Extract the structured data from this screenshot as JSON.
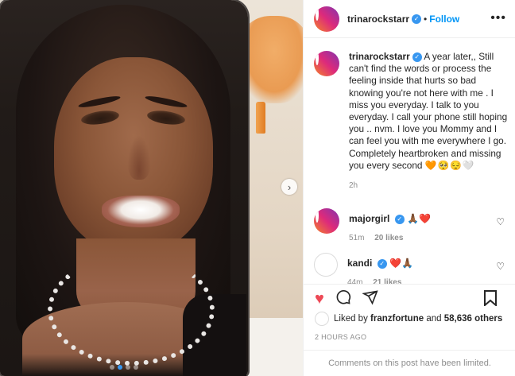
{
  "post": {
    "owner": "trinarockstarr",
    "follow_label": "Follow",
    "separator": "•",
    "more_icon": "more-horizontal-icon",
    "next_icon": "chevron-right-icon",
    "carousel_index": 2,
    "carousel_count": 4,
    "colors": {
      "accent": "#0095f6",
      "like": "#ed4956",
      "verified": "#3897f0",
      "muted": "#8e8e8e"
    }
  },
  "caption": {
    "username": "trinarockstarr",
    "text": "A year later,, Still can't find the words or process the feeling inside that hurts so bad knowing you're not here with me . I miss you everyday. I talk to you everyday. I call your phone still hoping you .. nvm. I love you Mommy and I can feel you with me everywhere I go. Completely heartbroken and missing you every second",
    "emojis": "🧡🥺😔🤍",
    "time": "2h"
  },
  "comments": [
    {
      "username": "majorgirl",
      "text": "🙏🏾❤️",
      "time": "51m",
      "likes": "20 likes"
    },
    {
      "username": "kandi",
      "text": "❤️🙏🏾",
      "time": "44m",
      "likes": "21 likes"
    }
  ],
  "actions": {
    "like_icon": "heart-filled-icon",
    "comment_icon": "comment-icon",
    "share_icon": "share-icon",
    "save_icon": "bookmark-icon"
  },
  "likes": {
    "prefix": "Liked by",
    "user": "franzfortune",
    "middle": "and",
    "count": "58,636 others"
  },
  "date": "2 HOURS AGO",
  "comments_limited": "Comments on this post have been limited."
}
